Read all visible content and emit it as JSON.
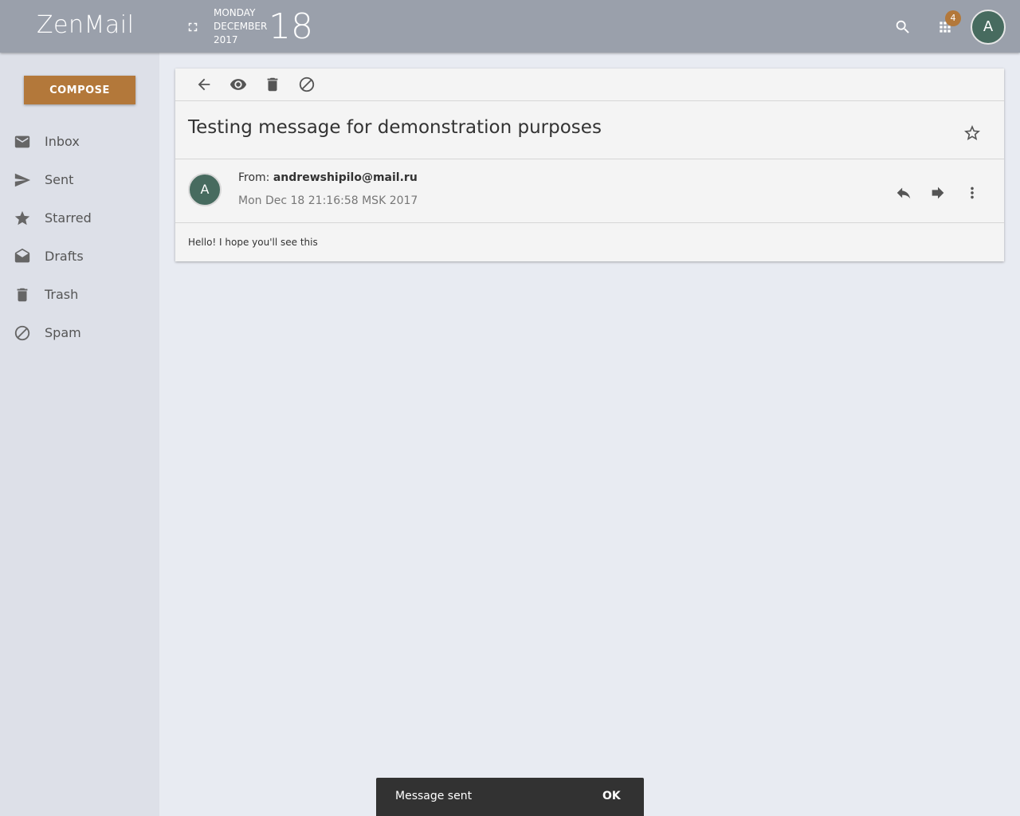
{
  "header": {
    "brand": "ZenMail",
    "date": {
      "weekday": "MONDAY",
      "month": "DECEMBER",
      "year": "2017",
      "day": "18"
    },
    "apps_badge_count": "4",
    "user_initial": "A",
    "icons": [
      "fullscreen-icon",
      "search-icon",
      "apps-grid-icon"
    ]
  },
  "sidebar": {
    "compose_label": "COMPOSE",
    "items": [
      {
        "label": "Inbox",
        "icon": "mail-icon"
      },
      {
        "label": "Sent",
        "icon": "send-icon"
      },
      {
        "label": "Starred",
        "icon": "star-icon"
      },
      {
        "label": "Drafts",
        "icon": "drafts-icon"
      },
      {
        "label": "Trash",
        "icon": "trash-icon"
      },
      {
        "label": "Spam",
        "icon": "block-icon"
      }
    ]
  },
  "message": {
    "toolbar_icons": [
      "back-icon",
      "eye-icon",
      "trash-icon",
      "block-icon"
    ],
    "subject": "Testing message for demonstration purposes",
    "from_prefix": "From:",
    "from_address": "andrewshipilo@mail.ru",
    "sender_initial": "A",
    "date": "Mon Dec 18 21:16:58 MSK 2017",
    "body": "Hello! I hope you'll see this",
    "action_icons": [
      "reply-icon",
      "forward-icon",
      "more-vert-icon"
    ]
  },
  "snackbar": {
    "message": "Message sent",
    "action": "OK"
  },
  "colors": {
    "accent": "#b3783a",
    "topbar": "#9aa0ab",
    "avatar": "#476b5f"
  }
}
